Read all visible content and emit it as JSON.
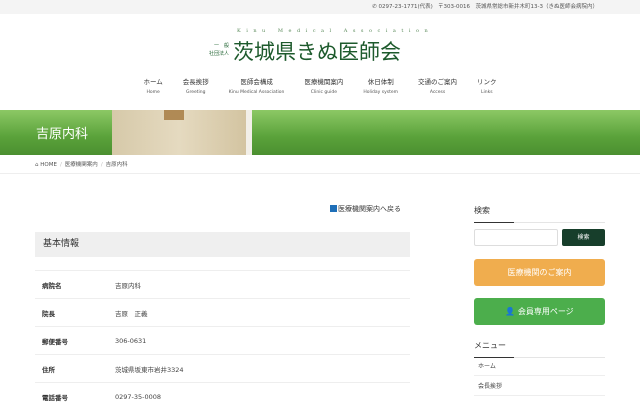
{
  "topbar": {
    "phone": "0297-23-1771(代表)",
    "address": "〒303-0016　茨城県常総市新井木町13-3（きぬ医師会病院内）"
  },
  "logo": {
    "en": "Kinu Medical Association",
    "corp_line1": "一　般",
    "corp_line2": "社団法人",
    "name": "茨城県きぬ医師会"
  },
  "nav": [
    {
      "ja": "ホーム",
      "en": "Home"
    },
    {
      "ja": "会長挨拶",
      "en": "Greeting"
    },
    {
      "ja": "医師会構成",
      "en": "Kinu Medical Association"
    },
    {
      "ja": "医療機関案内",
      "en": "Clinic guide"
    },
    {
      "ja": "休日体制",
      "en": "Holiday system"
    },
    {
      "ja": "交通のご案内",
      "en": "Access"
    },
    {
      "ja": "リンク",
      "en": "Links"
    }
  ],
  "page_title": "吉原内科",
  "breadcrumb": [
    "HOME",
    "医療機関案内",
    "吉原内科"
  ],
  "back_link": "医療機関案内へ戻る",
  "section_title": "基本情報",
  "rows": [
    {
      "k": "病院名",
      "v": "吉原内科"
    },
    {
      "k": "院長",
      "v": "吉原　正義"
    },
    {
      "k": "郵便番号",
      "v": "306-0631"
    },
    {
      "k": "住所",
      "v": "茨城県坂東市岩井3324"
    },
    {
      "k": "電話番号",
      "v": "0297-35-0008"
    }
  ],
  "sidebar": {
    "search_title": "検索",
    "search_button": "検索",
    "clinic_button": "医療機関のご案内",
    "member_button": "会員専用ページ",
    "menu_title": "メニュー",
    "menu": [
      "ホーム",
      "会長挨拶"
    ]
  },
  "colors": {
    "orange": "#f0ad4e",
    "green": "#4cae4c",
    "dark": "#173e2b"
  }
}
